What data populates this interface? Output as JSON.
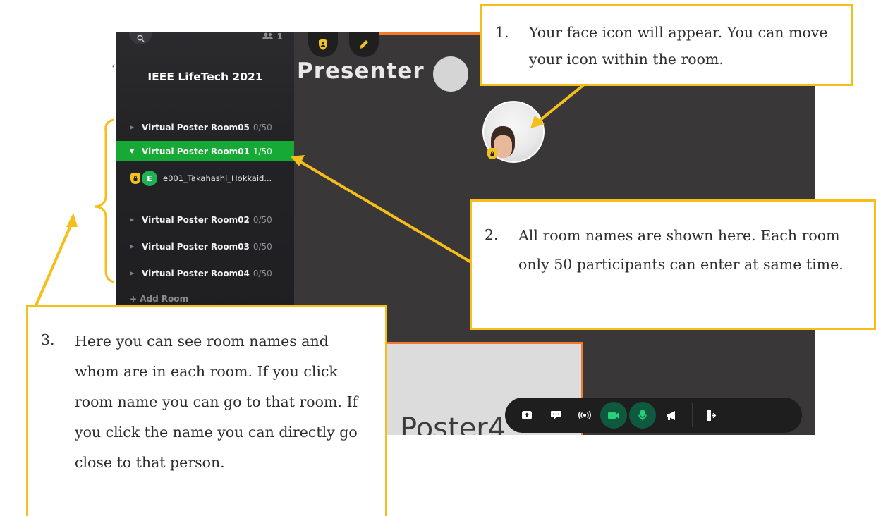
{
  "sidebar": {
    "title": "IEEE LifeTech 2021",
    "people_count": "1",
    "rooms": [
      {
        "name": "Virtual Poster Room05",
        "count": "0/50",
        "active": false
      },
      {
        "name": "Virtual Poster Room01",
        "count": "1/50",
        "active": true
      },
      {
        "name": "Virtual Poster Room02",
        "count": "0/50",
        "active": false
      },
      {
        "name": "Virtual Poster Room03",
        "count": "0/50",
        "active": false
      },
      {
        "name": "Virtual Poster Room04",
        "count": "0/50",
        "active": false
      }
    ],
    "user": {
      "initial": "E",
      "name": "e001_Takahashi_Hokkaid..."
    },
    "add_room": "+ Add Room"
  },
  "canvas": {
    "presenter_label": "Presenter",
    "poster_label": "Poster4"
  },
  "callouts": {
    "c1": {
      "num": "1.",
      "text": "Your face icon will appear. You can move your icon within the room."
    },
    "c2": {
      "num": "2.",
      "text": "All room names are shown here. Each room only 50 participants can enter at same time."
    },
    "c3": {
      "num": "3.",
      "text": "Here you can see room names and whom are in each room. If you click room name you can go to that room. If you click the name you can directly go close to that person."
    }
  },
  "colors": {
    "accent_green": "#16a935",
    "callout_border": "#f5be1a",
    "arrow": "#f5be1a",
    "poster_border": "#f27a2c"
  },
  "icons": {
    "toolbar": [
      "share-screen-icon",
      "chat-icon",
      "broadcast-icon",
      "camera-icon",
      "microphone-icon",
      "megaphone-icon",
      "exit-icon"
    ],
    "top": [
      "shield-icon",
      "pencil-icon"
    ]
  }
}
